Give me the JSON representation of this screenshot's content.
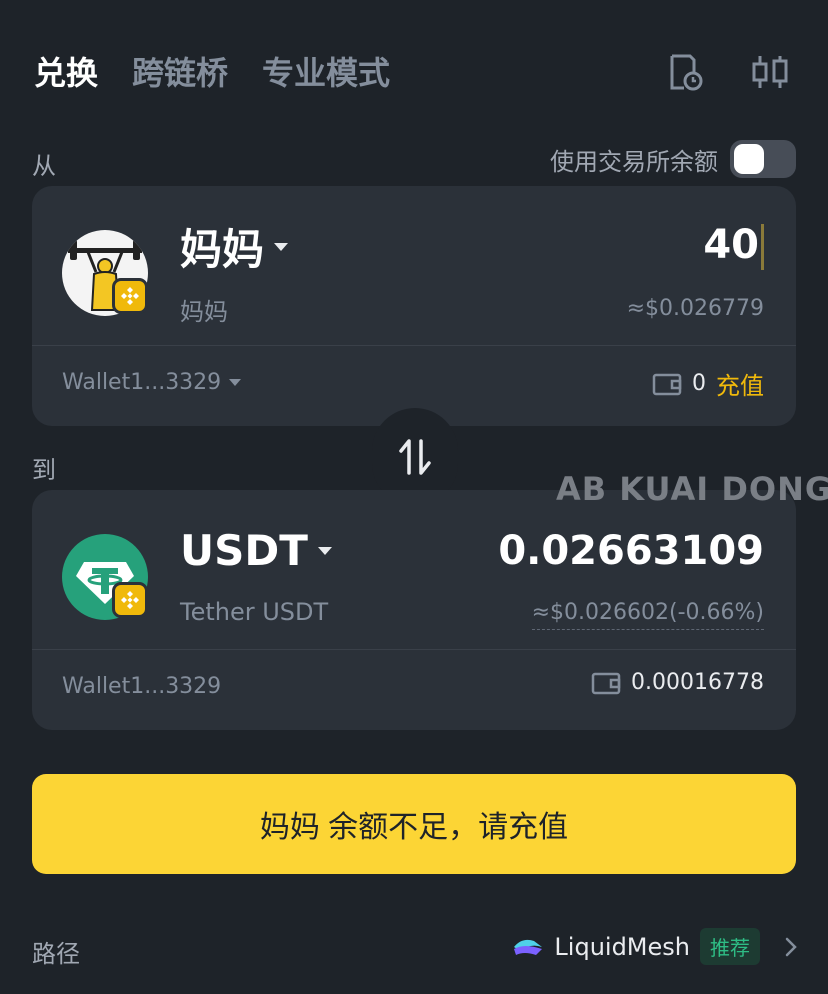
{
  "tabs": [
    {
      "label": "兑换",
      "active": true
    },
    {
      "label": "跨链桥",
      "active": false
    },
    {
      "label": "专业模式",
      "active": false
    }
  ],
  "top_icons": [
    "history-icon",
    "chart-settings-icon"
  ],
  "from_section": {
    "label": "从",
    "use_exchange_balance_label": "使用交易所余额",
    "use_exchange_balance_on": false,
    "token": {
      "symbol": "妈妈",
      "name": "妈妈"
    },
    "amount": "40",
    "usd_value": "≈$0.026779",
    "wallet": "Wallet1...3329",
    "balance": "0",
    "deposit_label": "充值"
  },
  "to_section": {
    "label": "到",
    "token": {
      "symbol": "USDT",
      "name": "Tether USDT"
    },
    "amount": "0.02663109",
    "usd_value": "≈$0.026602(-0.66%)",
    "wallet": "Wallet1...3329",
    "balance": "0.00016778"
  },
  "watermark": "AB KUAI DONG",
  "action_button": "妈妈 余额不足，请充值",
  "route": {
    "label": "路径",
    "provider": "LiquidMesh",
    "badge": "推荐"
  },
  "colors": {
    "background": "#1e2329",
    "card": "#2b3139",
    "accent_yellow": "#fcd535",
    "recommend_green": "#2ebd85"
  }
}
